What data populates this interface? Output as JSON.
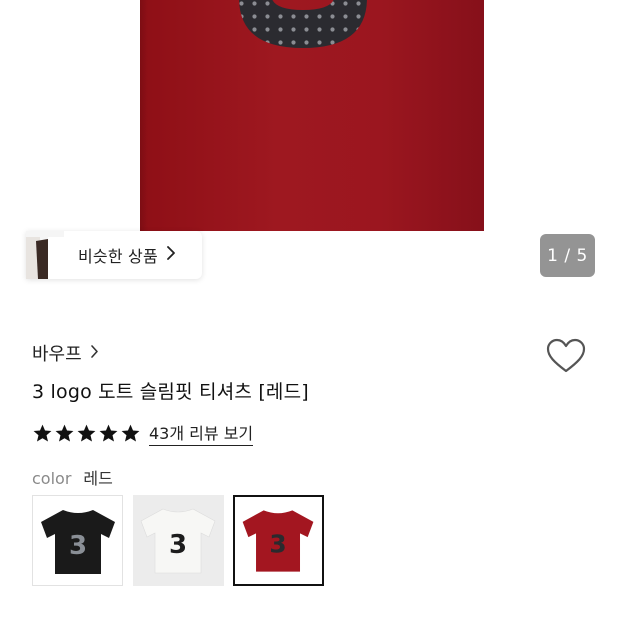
{
  "gallery": {
    "similar_label": "비슷한 상품",
    "page_indicator": "1 / 5"
  },
  "product": {
    "brand": "바우프",
    "title": "3 logo 도트 슬림핏 티셔츠 [레드]",
    "rating_stars": 5,
    "review_link": "43개 리뷰 보기",
    "color_key": "color",
    "color_value": "레드"
  },
  "swatches": [
    {
      "name": "black",
      "shirt_color": "#1a1a1a",
      "logo_color": "#8a8f96"
    },
    {
      "name": "white",
      "shirt_color": "#f4f4f2",
      "logo_color": "#1c1c1c"
    },
    {
      "name": "red",
      "shirt_color": "#a31620",
      "logo_color": "#2a2a2e"
    }
  ],
  "colors": {
    "hero_shirt": "#9b161f",
    "text": "#111111",
    "muted": "#8a8a8a",
    "indicator_bg": "rgba(60,60,60,0.55)"
  },
  "icons": {
    "similar_chevron": "chevron-right-icon",
    "brand_chevron": "chevron-right-icon",
    "wishlist": "heart-outline-icon",
    "star": "star-filled-icon"
  }
}
